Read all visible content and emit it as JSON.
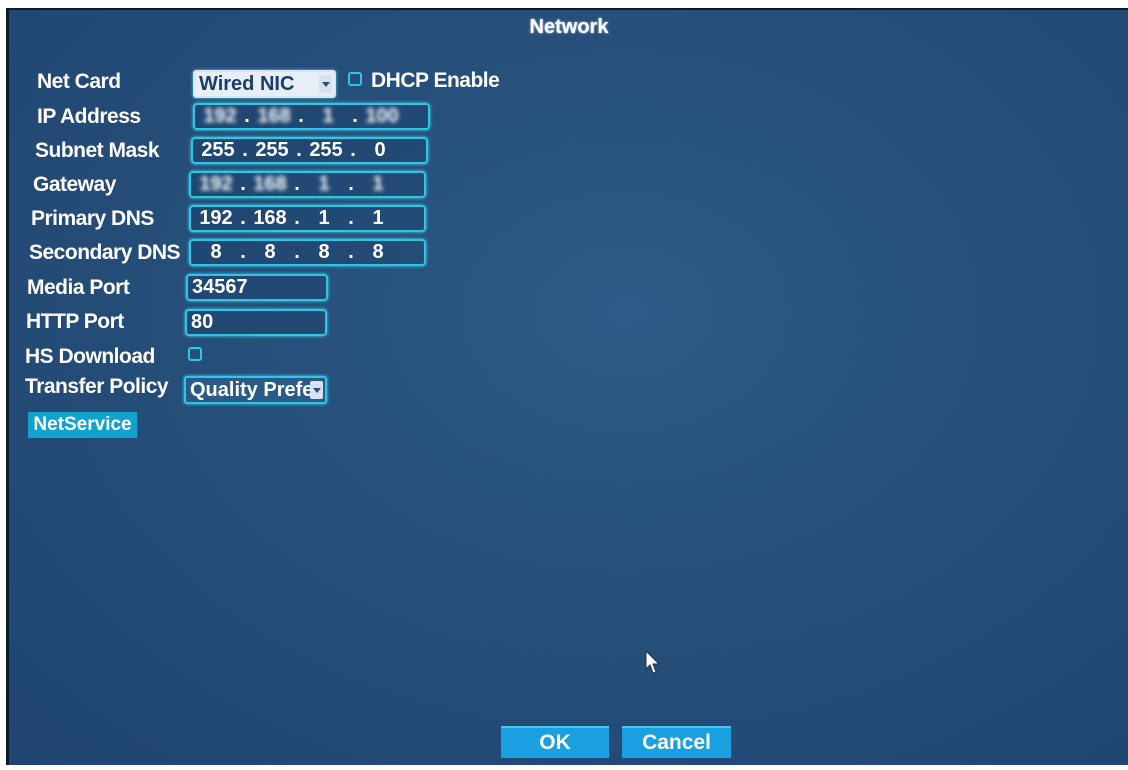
{
  "window": {
    "title": "Network"
  },
  "fields": {
    "net_card": {
      "label": "Net Card",
      "value": "Wired NIC"
    },
    "dhcp": {
      "label": "DHCP Enable",
      "checked": false
    },
    "ip_address": {
      "label": "IP Address",
      "octets": [
        "192",
        "168",
        "1",
        "100"
      ]
    },
    "subnet_mask": {
      "label": "Subnet Mask",
      "octets": [
        "255",
        "255",
        "255",
        "0"
      ]
    },
    "gateway": {
      "label": "Gateway",
      "octets": [
        "192",
        "168",
        "1",
        "1"
      ]
    },
    "primary_dns": {
      "label": "Primary DNS",
      "octets": [
        "192",
        "168",
        "1",
        "1"
      ]
    },
    "secondary_dns": {
      "label": "Secondary DNS",
      "octets": [
        "8",
        "8",
        "8",
        "8"
      ]
    },
    "media_port": {
      "label": "Media Port",
      "value": "34567"
    },
    "http_port": {
      "label": "HTTP Port",
      "value": "80"
    },
    "hs_download": {
      "label": "HS Download",
      "checked": false
    },
    "transfer_policy": {
      "label": "Transfer Policy",
      "value": "Quality Prefe"
    }
  },
  "netservice_label": "NetService",
  "buttons": {
    "ok": "OK",
    "cancel": "Cancel"
  },
  "colors": {
    "background": "#264f7a",
    "field_border": "#2ec6e6",
    "button": "#1a9fe0"
  },
  "icons": [
    "dropdown-arrow-icon",
    "checkbox-icon",
    "mouse-pointer-icon"
  ]
}
